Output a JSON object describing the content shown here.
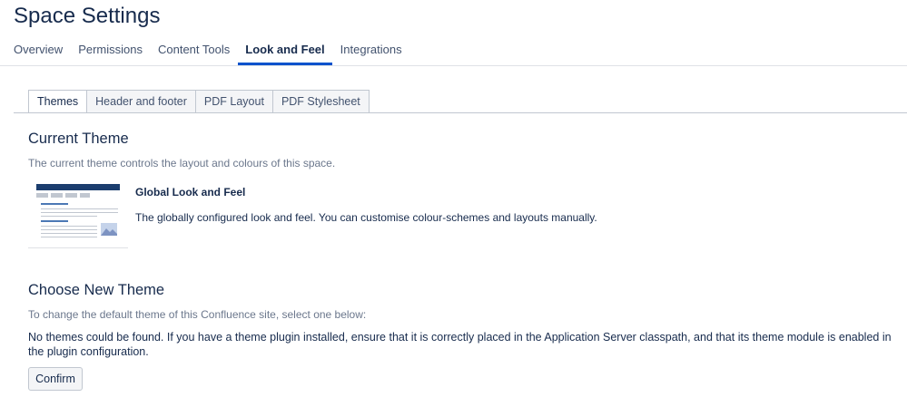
{
  "page": {
    "title": "Space Settings"
  },
  "main_tabs": [
    {
      "label": "Overview"
    },
    {
      "label": "Permissions"
    },
    {
      "label": "Content Tools"
    },
    {
      "label": "Look and Feel",
      "active": true
    },
    {
      "label": "Integrations"
    }
  ],
  "sub_tabs": [
    {
      "label": "Themes",
      "active": true
    },
    {
      "label": "Header and footer"
    },
    {
      "label": "PDF Layout"
    },
    {
      "label": "PDF Stylesheet"
    }
  ],
  "current_theme": {
    "heading": "Current Theme",
    "description": "The current theme controls the layout and colours of this space.",
    "name": "Global Look and Feel",
    "details": "The globally configured look and feel. You can customise colour-schemes and layouts manually."
  },
  "choose_theme": {
    "heading": "Choose New Theme",
    "description": "To change the default theme of this Confluence site, select one below:",
    "message": "No themes could be found. If you have a theme plugin installed, ensure that it is correctly placed in the Application Server classpath, and that its theme module is enabled in the plugin configuration.",
    "confirm_label": "Confirm"
  },
  "colors": {
    "accent": "#0052cc",
    "thumbnail_header": "#1b3d6e"
  }
}
